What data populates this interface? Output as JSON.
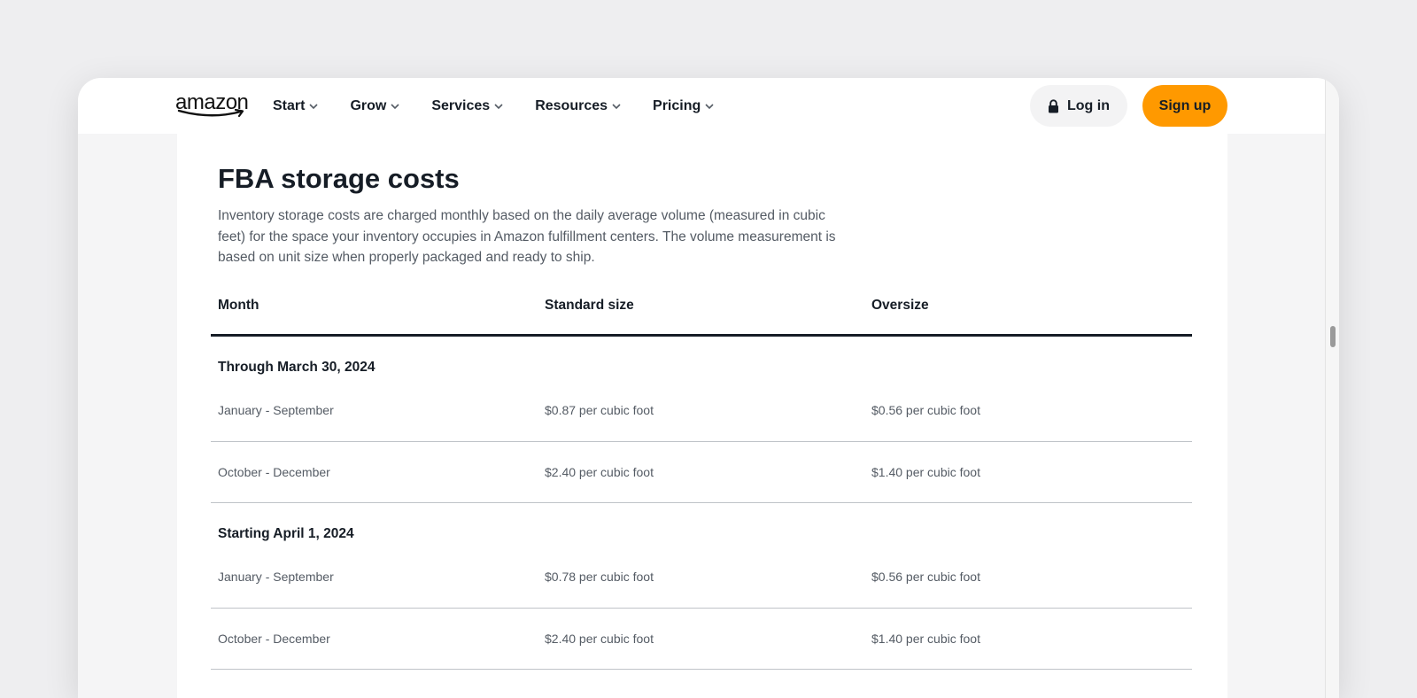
{
  "nav": {
    "logo_text": "amazon",
    "items": [
      {
        "label": "Start"
      },
      {
        "label": "Grow"
      },
      {
        "label": "Services"
      },
      {
        "label": "Resources"
      },
      {
        "label": "Pricing"
      }
    ],
    "login_label": "Log in",
    "signup_label": "Sign up"
  },
  "page": {
    "title": "FBA storage costs",
    "description": "Inventory storage costs are charged monthly based on the daily average volume (measured in cubic feet) for the space your inventory occupies in Amazon fulfillment centers. The volume measurement is based on unit size when properly packaged and ready to ship."
  },
  "table": {
    "headers": [
      "Month",
      "Standard size",
      "Oversize"
    ],
    "sections": [
      {
        "heading": "Through March 30, 2024",
        "rows": [
          [
            "January - September",
            "$0.87 per cubic foot",
            "$0.56 per cubic foot"
          ],
          [
            "October - December",
            "$2.40 per cubic foot",
            "$1.40 per cubic foot"
          ]
        ]
      },
      {
        "heading": "Starting April 1, 2024",
        "rows": [
          [
            "January - September",
            "$0.78 per cubic foot",
            "$0.56 per cubic foot"
          ],
          [
            "October - December",
            "$2.40 per cubic foot",
            "$1.40 per cubic foot"
          ]
        ]
      }
    ]
  },
  "colors": {
    "accent": "#ff9900",
    "text_dark": "#161d26",
    "text_muted": "#545b64",
    "page_bg": "#eeeef0"
  },
  "icons": [
    "amazon-smile-logo",
    "chevron-down-icon",
    "lock-icon"
  ]
}
